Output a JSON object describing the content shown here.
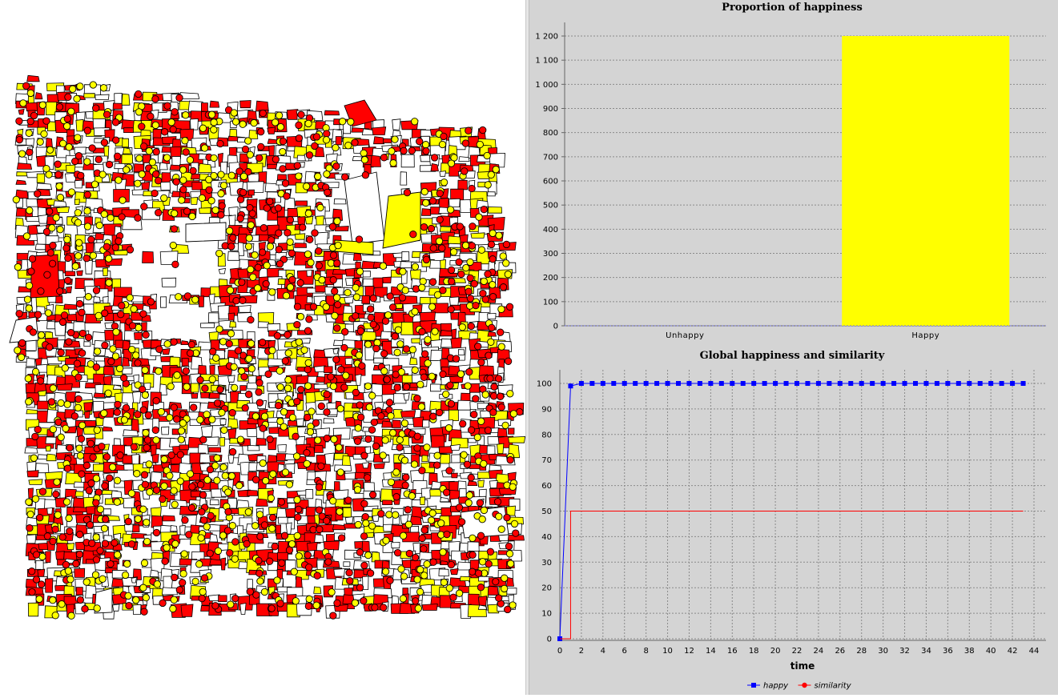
{
  "map": {
    "colors": {
      "red": "#ff0000",
      "yellow": "#ffff00",
      "empty": "#ffffff",
      "outline": "#000000"
    },
    "agents_description_label": ""
  },
  "chart_data": [
    {
      "type": "bar",
      "title": "Proportion of happiness",
      "categories": [
        "Unhappy",
        "Happy"
      ],
      "values": [
        0,
        1200
      ],
      "colors": [
        "#ff0000",
        "#ffff00"
      ],
      "ylim": [
        0,
        1200
      ],
      "yticks": [
        "0",
        "100",
        "200",
        "300",
        "400",
        "500",
        "600",
        "700",
        "800",
        "900",
        "1 000",
        "1 100",
        "1 200"
      ],
      "grid": true
    },
    {
      "type": "line",
      "title": "Global happiness and similarity",
      "xlabel": "time",
      "xlim": [
        0,
        44
      ],
      "ylim": [
        0,
        100
      ],
      "xticks": [
        "0",
        "2",
        "4",
        "6",
        "8",
        "10",
        "12",
        "14",
        "16",
        "18",
        "20",
        "22",
        "24",
        "26",
        "28",
        "30",
        "32",
        "34",
        "36",
        "38",
        "40",
        "42",
        "44"
      ],
      "yticks": [
        "0",
        "10",
        "20",
        "30",
        "40",
        "50",
        "60",
        "70",
        "80",
        "90",
        "100"
      ],
      "x": [
        0,
        1,
        2,
        3,
        4,
        5,
        6,
        7,
        8,
        9,
        10,
        11,
        12,
        13,
        14,
        15,
        16,
        17,
        18,
        19,
        20,
        21,
        22,
        23,
        24,
        25,
        26,
        27,
        28,
        29,
        30,
        31,
        32,
        33,
        34,
        35,
        36,
        37,
        38,
        39,
        40,
        41,
        42,
        43
      ],
      "series": [
        {
          "name": "happy",
          "color": "#0000ff",
          "marker": "square",
          "values": [
            0,
            99,
            100,
            100,
            100,
            100,
            100,
            100,
            100,
            100,
            100,
            100,
            100,
            100,
            100,
            100,
            100,
            100,
            100,
            100,
            100,
            100,
            100,
            100,
            100,
            100,
            100,
            100,
            100,
            100,
            100,
            100,
            100,
            100,
            100,
            100,
            100,
            100,
            100,
            100,
            100,
            100,
            100,
            100
          ]
        },
        {
          "name": "similarity",
          "color": "#ff0000",
          "marker": "circle",
          "values": [
            0,
            50,
            50,
            50,
            50,
            50,
            50,
            50,
            50,
            50,
            50,
            50,
            50,
            50,
            50,
            50,
            50,
            50,
            50,
            50,
            50,
            50,
            50,
            50,
            50,
            50,
            50,
            50,
            50,
            50,
            50,
            50,
            50,
            50,
            50,
            50,
            50,
            50,
            50,
            50,
            50,
            50,
            50,
            50
          ]
        }
      ],
      "legend_position": "bottom",
      "grid": true
    }
  ]
}
